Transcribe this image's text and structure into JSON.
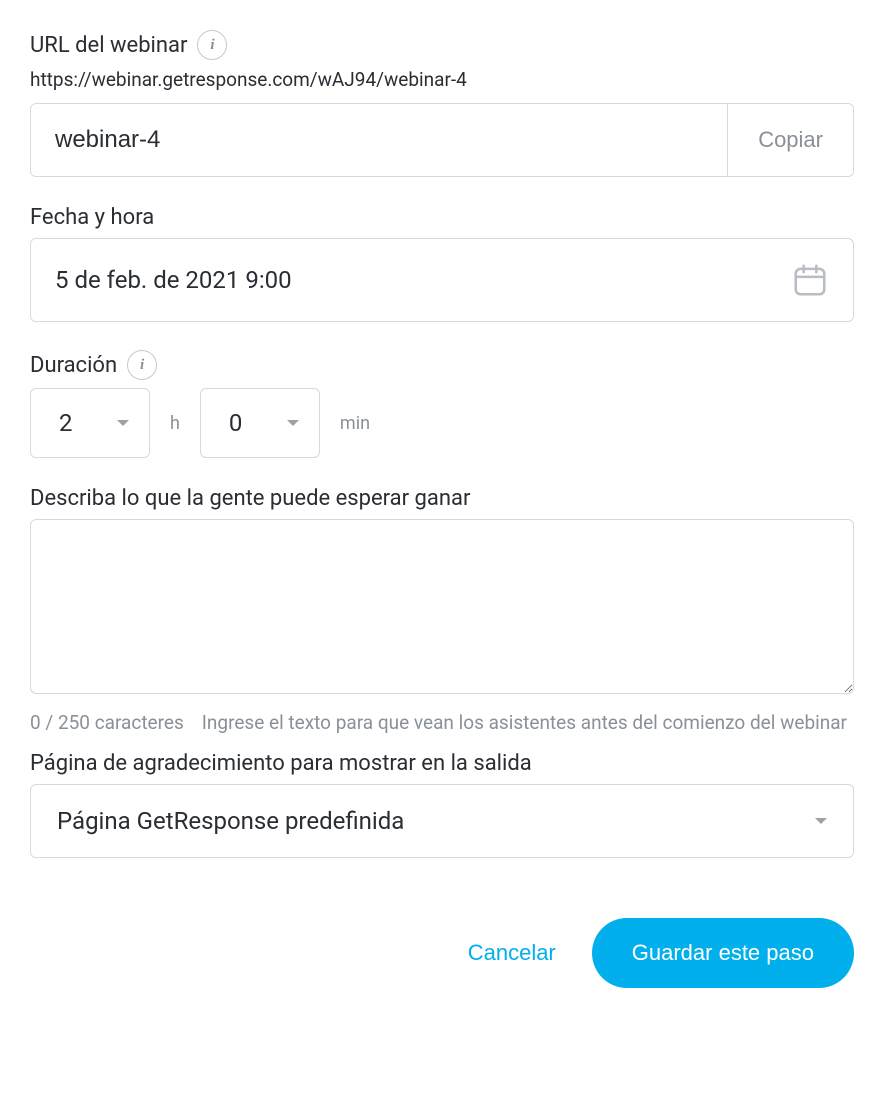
{
  "url_section": {
    "label": "URL del webinar",
    "full_url": "https://webinar.getresponse.com/wAJ94/webinar-4",
    "slug_value": "webinar-4",
    "copy_label": "Copiar"
  },
  "datetime_section": {
    "label": "Fecha y hora",
    "value": "5 de feb. de 2021 9:00"
  },
  "duration_section": {
    "label": "Duración",
    "hours_value": "2",
    "hours_unit": "h",
    "minutes_value": "0",
    "minutes_unit": "min"
  },
  "description_section": {
    "label": "Describa lo que la gente puede esperar ganar",
    "value": "",
    "char_count": "0 / 250 caracteres",
    "helper": "Ingrese el texto para que vean los asistentes antes del comienzo del webinar"
  },
  "thankyou_section": {
    "label": "Página de agradecimiento para mostrar en la salida",
    "selected": "Página GetResponse predefinida"
  },
  "actions": {
    "cancel": "Cancelar",
    "save": "Guardar este paso"
  }
}
